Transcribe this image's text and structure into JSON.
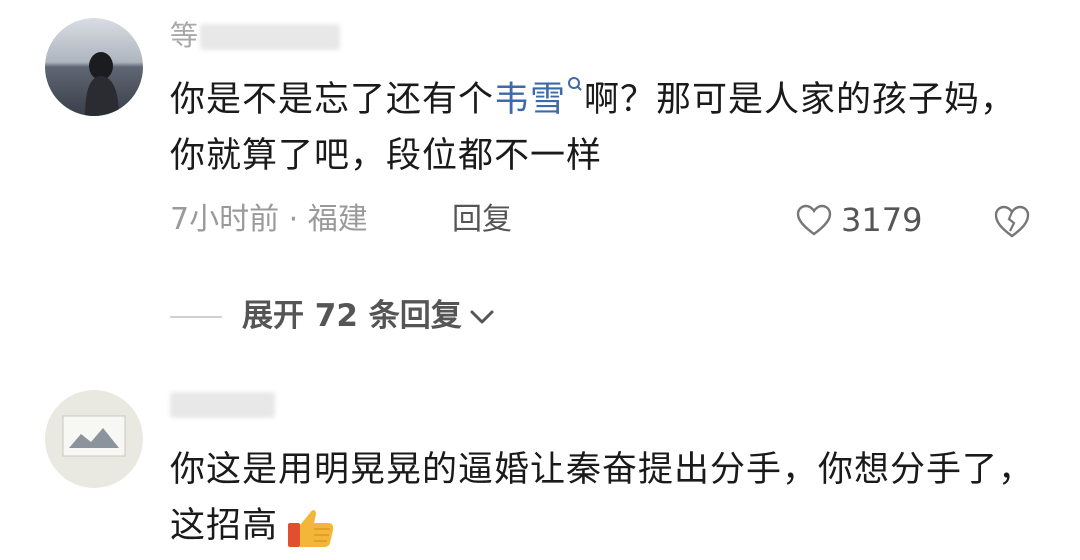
{
  "comments": [
    {
      "username": "等",
      "text_before": "你是不是忘了还有个",
      "link_text": "韦雪",
      "text_after": "啊？那可是人家的孩子妈，你就算了吧，段位都不一样",
      "time_location": "7小时前 · 福建",
      "reply_label": "回复",
      "like_count": "3179"
    },
    {
      "username": "",
      "text": "你这是用明晃晃的逼婚让秦奋提出分手，你想分手了，这招高"
    }
  ],
  "expand_replies": {
    "label": "展开 72 条回复"
  },
  "colors": {
    "link": "#3d6aa8",
    "text": "#1a1a1a",
    "meta": "#9a9a9a",
    "emoji": "#f3b638"
  },
  "icons": [
    "search-icon",
    "heart-icon",
    "broken-heart-icon",
    "chevron-down-icon",
    "thumbs-up-emoji"
  ]
}
